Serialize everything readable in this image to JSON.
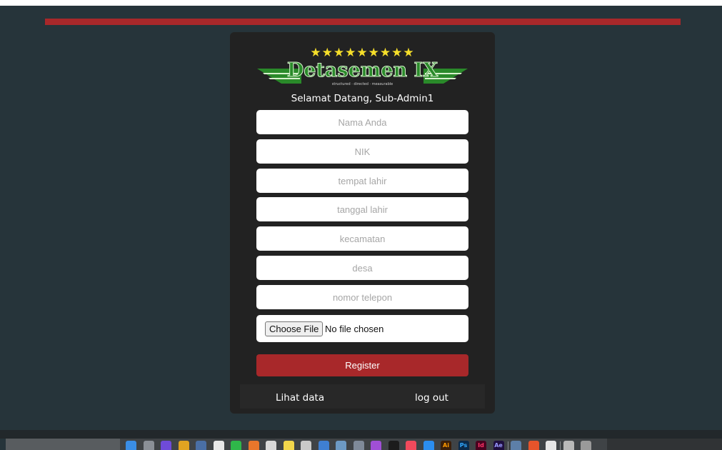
{
  "app": {
    "logo_stars": "★★★★★★★★★",
    "logo_text": "Detasemen IX",
    "logo_tagline": "structured · directed · measurable",
    "welcome": "Selamat Datang, Sub-Admin1"
  },
  "form": {
    "nama_placeholder": "Nama Anda",
    "nik_placeholder": "NIK",
    "tempat_lahir_placeholder": "tempat lahir",
    "tanggal_lahir_placeholder": "tanggal lahir",
    "kecamatan_placeholder": "kecamatan",
    "desa_placeholder": "desa",
    "telepon_placeholder": "nomor telepon",
    "file_button": "Choose File",
    "file_status": "No file chosen",
    "register_label": "Register"
  },
  "nav": {
    "lihat_data": "Lihat data",
    "logout": "log out"
  },
  "colors": {
    "page_background": "#26343a",
    "panel": "#222222",
    "accent_red": "#a8282a",
    "logo_green": "#2a8a2a",
    "logo_stars": "#f6df2a"
  },
  "dock": {
    "items": [
      {
        "name": "finder-icon",
        "color": "#3a8ee6",
        "glyph": ""
      },
      {
        "name": "launchpad-icon",
        "color": "#8b9097",
        "glyph": ""
      },
      {
        "name": "siri-icon",
        "color": "#6f4bd8",
        "glyph": ""
      },
      {
        "name": "chrome-icon",
        "color": "#e0a321",
        "glyph": ""
      },
      {
        "name": "notes-icon",
        "color": "#4a6fa5",
        "glyph": ""
      },
      {
        "name": "calendar-icon",
        "color": "#e8e8e8",
        "glyph": ""
      },
      {
        "name": "whatsapp-icon",
        "color": "#2fb84a",
        "glyph": ""
      },
      {
        "name": "books-icon",
        "color": "#e9762b",
        "glyph": ""
      },
      {
        "name": "document-icon",
        "color": "#d9d9d9",
        "glyph": ""
      },
      {
        "name": "stickies-icon",
        "color": "#f2d64b",
        "glyph": ""
      },
      {
        "name": "files-icon",
        "color": "#c9c9c9",
        "glyph": ""
      },
      {
        "name": "charts-icon",
        "color": "#3f7fd1",
        "glyph": ""
      },
      {
        "name": "scripts-icon",
        "color": "#6d9ac4",
        "glyph": ""
      },
      {
        "name": "photos-icon",
        "color": "#7f8a99",
        "glyph": ""
      },
      {
        "name": "podcasts-icon",
        "color": "#a04fd6",
        "glyph": ""
      },
      {
        "name": "tv-icon",
        "color": "#1c1c1c",
        "glyph": ""
      },
      {
        "name": "music-icon",
        "color": "#f24a5c",
        "glyph": ""
      },
      {
        "name": "app-store-icon",
        "color": "#2b8ef0",
        "glyph": ""
      },
      {
        "name": "illustrator-icon",
        "color": "#3b1f0a",
        "glyph": "Ai"
      },
      {
        "name": "photoshop-icon",
        "color": "#0b2a4a",
        "glyph": "Ps"
      },
      {
        "name": "indesign-icon",
        "color": "#49021f",
        "glyph": "Id"
      },
      {
        "name": "after-effects-icon",
        "color": "#1f0f3f",
        "glyph": "Ae"
      },
      {
        "name": "preview-icon",
        "color": "#5d7fa8",
        "glyph": ""
      },
      {
        "name": "browser-icon",
        "color": "#e6542b",
        "glyph": ""
      },
      {
        "name": "pages-icon",
        "color": "#e6e6e6",
        "glyph": ""
      },
      {
        "name": "printer-icon",
        "color": "#b9b9b9",
        "glyph": ""
      },
      {
        "name": "trash-icon",
        "color": "#9a9a9a",
        "glyph": ""
      }
    ]
  }
}
